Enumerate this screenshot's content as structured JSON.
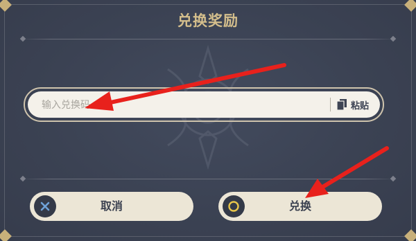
{
  "dialog": {
    "title": "兑换奖励"
  },
  "code_input": {
    "placeholder": "输入兑换码",
    "value": ""
  },
  "paste": {
    "label": "粘贴",
    "icon": "paste-icon"
  },
  "buttons": {
    "cancel_label": "取消",
    "cancel_icon": "close-x-icon",
    "confirm_label": "兑换",
    "confirm_icon": "confirm-circle-icon"
  },
  "colors": {
    "background": "#3b4253",
    "title": "#d4be8c",
    "button_fill": "#ece6d6",
    "input_fill": "#f4f1ea",
    "annotation_arrow": "#e8211c"
  }
}
